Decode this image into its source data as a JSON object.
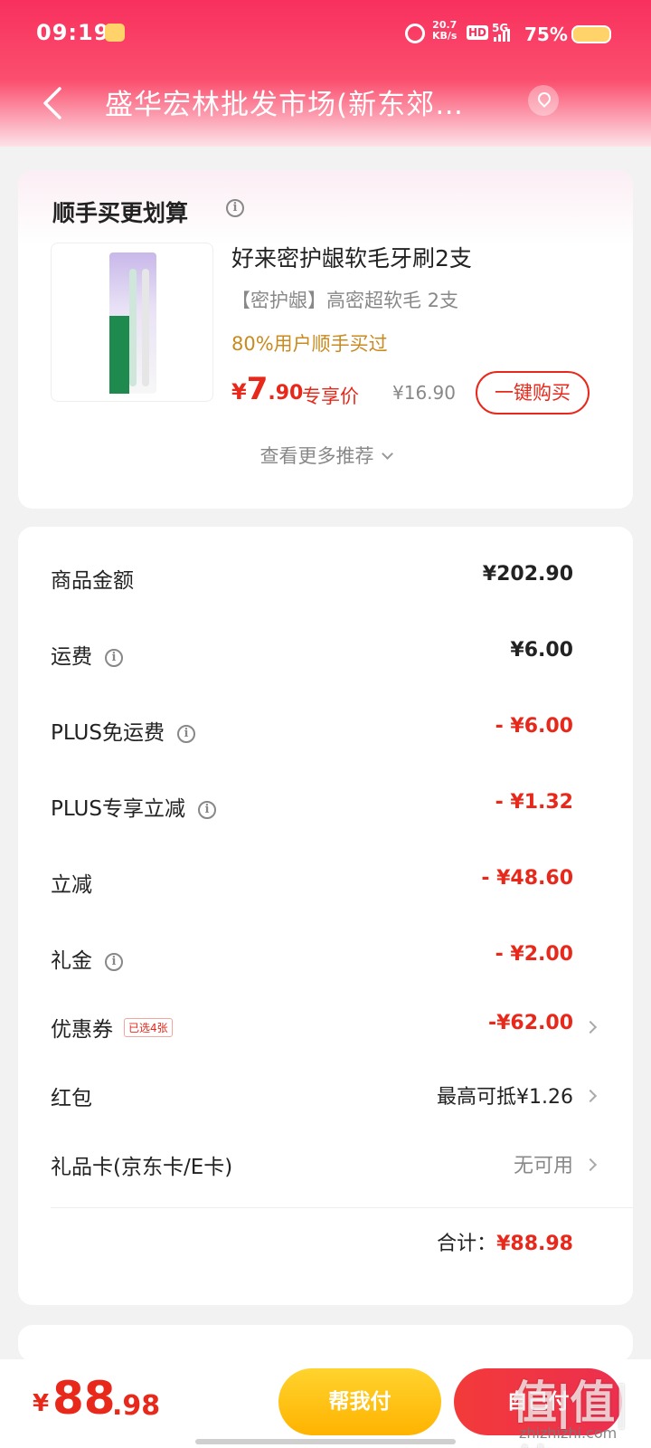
{
  "status_bar": {
    "time": "09:19",
    "net_speed_value": "20.7",
    "net_speed_unit": "KB/s",
    "hd": "HD",
    "network": "5G",
    "battery": "75%"
  },
  "nav": {
    "title": "盛华宏林批发市场(新东郊…"
  },
  "recommend": {
    "title": "顺手买更划算",
    "product_name": "好来密护龈软毛牙刷2支",
    "product_spec": "【密护龈】高密超软毛 2支",
    "buyers_text": "80%用户顺手买过",
    "price_symbol": "¥",
    "price_int": "7",
    "price_dec": ".90",
    "price_tag": "专享价",
    "original_price": "¥16.90",
    "buy_button": "一键购买",
    "more_link": "查看更多推荐"
  },
  "summary": {
    "rows": [
      {
        "label": "商品金额",
        "value": "¥202.90"
      },
      {
        "label": "运费",
        "value": "¥6.00"
      },
      {
        "label": "PLUS免运费",
        "value": "- ¥6.00"
      },
      {
        "label": "PLUS专享立减",
        "value": "- ¥1.32"
      },
      {
        "label": "立减",
        "value": "- ¥48.60"
      },
      {
        "label": "礼金",
        "value": "- ¥2.00"
      },
      {
        "label": "优惠券",
        "badge": "已选4张",
        "value": "-¥62.00"
      },
      {
        "label": "红包",
        "value": "最高可抵¥1.26"
      },
      {
        "label": "礼品卡(京东卡/E卡)",
        "value": "无可用"
      }
    ],
    "total_label": "合计：",
    "total_value": "¥88.98"
  },
  "bottom": {
    "price_symbol": "¥",
    "price_int": "88",
    "price_dec": ".98",
    "help_pay": "帮我付",
    "self_pay": "自己付"
  },
  "watermark": {
    "big": "值|值|值",
    "site": "zhizhizhi.com"
  },
  "colors": {
    "brand_red": "#e8281a",
    "header_pink": "#f8305e",
    "help_yellow": "#ffc21a"
  }
}
